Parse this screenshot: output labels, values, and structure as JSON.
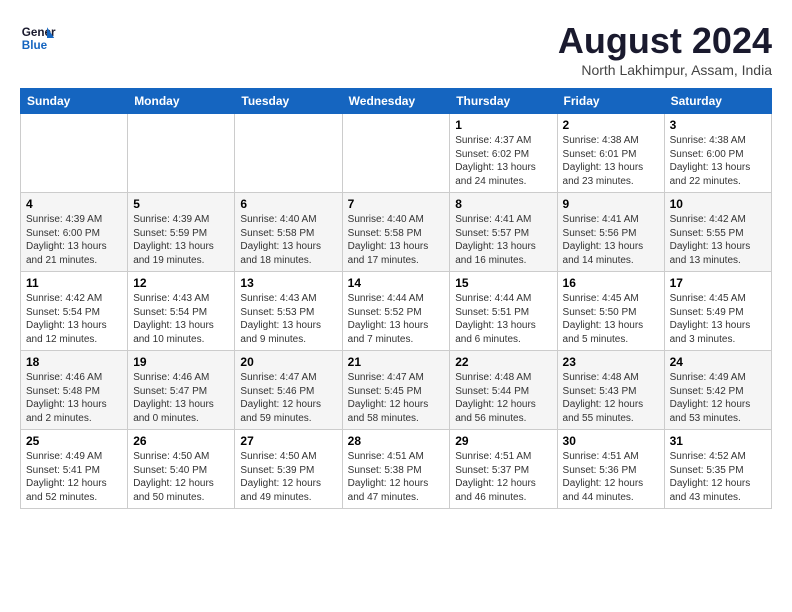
{
  "logo": {
    "line1": "General",
    "line2": "Blue"
  },
  "title": {
    "month_year": "August 2024",
    "location": "North Lakhimpur, Assam, India"
  },
  "weekdays": [
    "Sunday",
    "Monday",
    "Tuesday",
    "Wednesday",
    "Thursday",
    "Friday",
    "Saturday"
  ],
  "weeks": [
    [
      {
        "day": "",
        "info": ""
      },
      {
        "day": "",
        "info": ""
      },
      {
        "day": "",
        "info": ""
      },
      {
        "day": "",
        "info": ""
      },
      {
        "day": "1",
        "info": "Sunrise: 4:37 AM\nSunset: 6:02 PM\nDaylight: 13 hours and 24 minutes."
      },
      {
        "day": "2",
        "info": "Sunrise: 4:38 AM\nSunset: 6:01 PM\nDaylight: 13 hours and 23 minutes."
      },
      {
        "day": "3",
        "info": "Sunrise: 4:38 AM\nSunset: 6:00 PM\nDaylight: 13 hours and 22 minutes."
      }
    ],
    [
      {
        "day": "4",
        "info": "Sunrise: 4:39 AM\nSunset: 6:00 PM\nDaylight: 13 hours and 21 minutes."
      },
      {
        "day": "5",
        "info": "Sunrise: 4:39 AM\nSunset: 5:59 PM\nDaylight: 13 hours and 19 minutes."
      },
      {
        "day": "6",
        "info": "Sunrise: 4:40 AM\nSunset: 5:58 PM\nDaylight: 13 hours and 18 minutes."
      },
      {
        "day": "7",
        "info": "Sunrise: 4:40 AM\nSunset: 5:58 PM\nDaylight: 13 hours and 17 minutes."
      },
      {
        "day": "8",
        "info": "Sunrise: 4:41 AM\nSunset: 5:57 PM\nDaylight: 13 hours and 16 minutes."
      },
      {
        "day": "9",
        "info": "Sunrise: 4:41 AM\nSunset: 5:56 PM\nDaylight: 13 hours and 14 minutes."
      },
      {
        "day": "10",
        "info": "Sunrise: 4:42 AM\nSunset: 5:55 PM\nDaylight: 13 hours and 13 minutes."
      }
    ],
    [
      {
        "day": "11",
        "info": "Sunrise: 4:42 AM\nSunset: 5:54 PM\nDaylight: 13 hours and 12 minutes."
      },
      {
        "day": "12",
        "info": "Sunrise: 4:43 AM\nSunset: 5:54 PM\nDaylight: 13 hours and 10 minutes."
      },
      {
        "day": "13",
        "info": "Sunrise: 4:43 AM\nSunset: 5:53 PM\nDaylight: 13 hours and 9 minutes."
      },
      {
        "day": "14",
        "info": "Sunrise: 4:44 AM\nSunset: 5:52 PM\nDaylight: 13 hours and 7 minutes."
      },
      {
        "day": "15",
        "info": "Sunrise: 4:44 AM\nSunset: 5:51 PM\nDaylight: 13 hours and 6 minutes."
      },
      {
        "day": "16",
        "info": "Sunrise: 4:45 AM\nSunset: 5:50 PM\nDaylight: 13 hours and 5 minutes."
      },
      {
        "day": "17",
        "info": "Sunrise: 4:45 AM\nSunset: 5:49 PM\nDaylight: 13 hours and 3 minutes."
      }
    ],
    [
      {
        "day": "18",
        "info": "Sunrise: 4:46 AM\nSunset: 5:48 PM\nDaylight: 13 hours and 2 minutes."
      },
      {
        "day": "19",
        "info": "Sunrise: 4:46 AM\nSunset: 5:47 PM\nDaylight: 13 hours and 0 minutes."
      },
      {
        "day": "20",
        "info": "Sunrise: 4:47 AM\nSunset: 5:46 PM\nDaylight: 12 hours and 59 minutes."
      },
      {
        "day": "21",
        "info": "Sunrise: 4:47 AM\nSunset: 5:45 PM\nDaylight: 12 hours and 58 minutes."
      },
      {
        "day": "22",
        "info": "Sunrise: 4:48 AM\nSunset: 5:44 PM\nDaylight: 12 hours and 56 minutes."
      },
      {
        "day": "23",
        "info": "Sunrise: 4:48 AM\nSunset: 5:43 PM\nDaylight: 12 hours and 55 minutes."
      },
      {
        "day": "24",
        "info": "Sunrise: 4:49 AM\nSunset: 5:42 PM\nDaylight: 12 hours and 53 minutes."
      }
    ],
    [
      {
        "day": "25",
        "info": "Sunrise: 4:49 AM\nSunset: 5:41 PM\nDaylight: 12 hours and 52 minutes."
      },
      {
        "day": "26",
        "info": "Sunrise: 4:50 AM\nSunset: 5:40 PM\nDaylight: 12 hours and 50 minutes."
      },
      {
        "day": "27",
        "info": "Sunrise: 4:50 AM\nSunset: 5:39 PM\nDaylight: 12 hours and 49 minutes."
      },
      {
        "day": "28",
        "info": "Sunrise: 4:51 AM\nSunset: 5:38 PM\nDaylight: 12 hours and 47 minutes."
      },
      {
        "day": "29",
        "info": "Sunrise: 4:51 AM\nSunset: 5:37 PM\nDaylight: 12 hours and 46 minutes."
      },
      {
        "day": "30",
        "info": "Sunrise: 4:51 AM\nSunset: 5:36 PM\nDaylight: 12 hours and 44 minutes."
      },
      {
        "day": "31",
        "info": "Sunrise: 4:52 AM\nSunset: 5:35 PM\nDaylight: 12 hours and 43 minutes."
      }
    ]
  ]
}
